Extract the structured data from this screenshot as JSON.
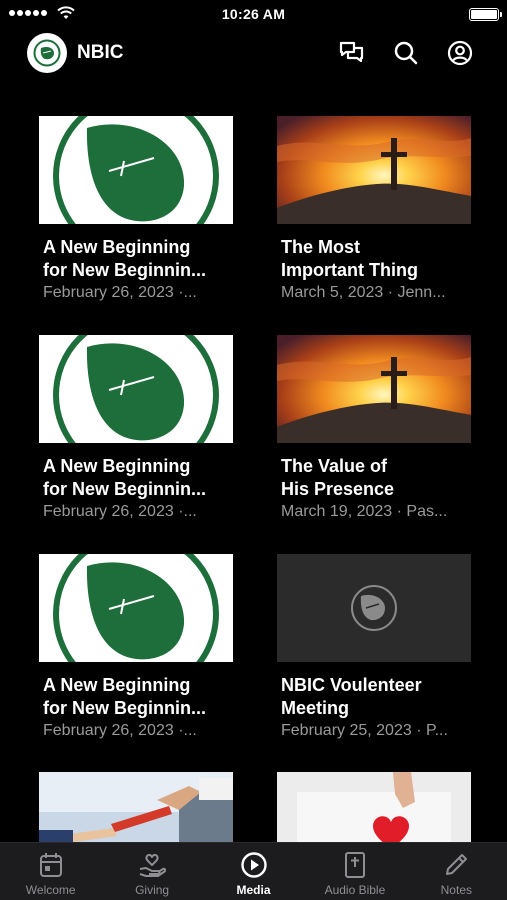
{
  "status_bar": {
    "time": "10:26 AM"
  },
  "header": {
    "title": "NBIC"
  },
  "colors": {
    "accent": "#1d6e3a",
    "background": "#000000",
    "meta_text": "#9a9a9a",
    "tab_bar": "#1c1c1e"
  },
  "cards": [
    {
      "title": "A New Beginning\nfor New Beginnin...",
      "meta": "February 26, 2023 ·...",
      "thumb": "leaf-logo"
    },
    {
      "title": "The Most\nImportant Thing",
      "meta": "March 5, 2023 · Jenn...",
      "thumb": "cross-sunset"
    },
    {
      "title": "A New Beginning\nfor New Beginnin...",
      "meta": "February 26, 2023 ·...",
      "thumb": "leaf-logo"
    },
    {
      "title": "The Value of\nHis Presence",
      "meta": "March 19, 2023 · Pas...",
      "thumb": "cross-sunset"
    },
    {
      "title": "A New Beginning\nfor New Beginnin...",
      "meta": "February 26, 2023 ·...",
      "thumb": "leaf-logo"
    },
    {
      "title": "NBIC Voulenteer\nMeeting",
      "meta": "February 25, 2023 · P...",
      "thumb": "placeholder-logo"
    },
    {
      "title": "",
      "meta": "",
      "thumb": "relay-baton"
    },
    {
      "title": "",
      "meta": "",
      "thumb": "heart-hand"
    }
  ],
  "tabs": [
    {
      "label": "Welcome",
      "icon": "calendar-icon",
      "active": false
    },
    {
      "label": "Giving",
      "icon": "giving-hand-icon",
      "active": false
    },
    {
      "label": "Media",
      "icon": "play-circle-icon",
      "active": true
    },
    {
      "label": "Audio Bible",
      "icon": "bible-icon",
      "active": false
    },
    {
      "label": "Notes",
      "icon": "pencil-icon",
      "active": false
    }
  ]
}
